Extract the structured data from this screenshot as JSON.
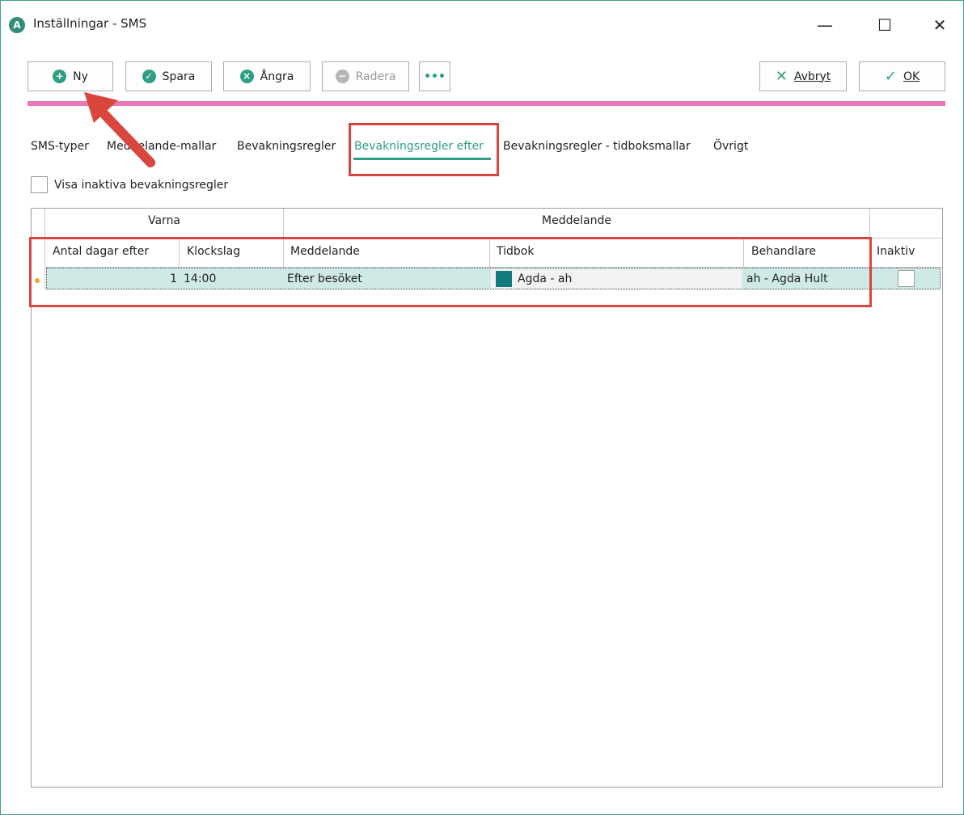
{
  "window": {
    "app_icon_letter": "A",
    "title": "Inställningar - SMS",
    "minimize": "—",
    "maximize": "☐",
    "close": "✕"
  },
  "toolbar": {
    "new_label": "Ny",
    "save_label": "Spara",
    "undo_label": "Ångra",
    "delete_label": "Radera",
    "more_label": "•••",
    "cancel_label": "Avbryt",
    "ok_label": "OK"
  },
  "tabs": [
    {
      "label": "SMS-typer"
    },
    {
      "label": "Meddelande-mallar"
    },
    {
      "label": "Bevakningsregler"
    },
    {
      "label": "Bevakningsregler efter"
    },
    {
      "label": "Bevakningsregler - tidboksmallar"
    },
    {
      "label": "Övrigt"
    }
  ],
  "active_tab": "Bevakningsregler efter",
  "show_inactive_label": "Visa inaktiva bevakningsregler",
  "grid": {
    "group_headers": [
      "Varna",
      "Meddelande"
    ],
    "columns": [
      "Antal dagar efter",
      "Klockslag",
      "Meddelande",
      "Tidbok",
      "Behandlare",
      "Inaktiv"
    ],
    "rows": [
      {
        "days": "1",
        "time": "14:00",
        "message": "Efter besöket",
        "book": "Agda - ah",
        "book_color": "#117a7a",
        "practitioner": "ah - Agda Hult",
        "inactive": false
      }
    ]
  },
  "colors": {
    "accent": "#2e9e84",
    "highlight_bar": "#e879b6",
    "annotation": "#d9463e",
    "selected_row": "#cfe9e6"
  }
}
